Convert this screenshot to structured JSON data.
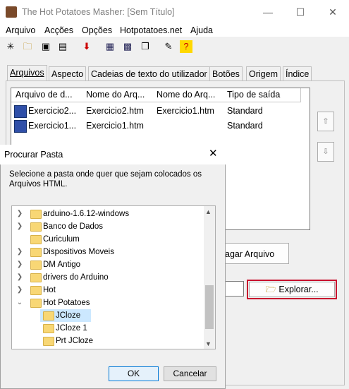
{
  "window": {
    "title": "The Hot Potatoes Masher: [Sem Título]"
  },
  "menu": [
    "Arquivo",
    "Acções",
    "Opções",
    "Hotpotatoes.net",
    "Ajuda"
  ],
  "tabs": [
    "Arquivos",
    "Aspecto",
    "Cadeias de texto do utilizador",
    "Botões",
    "Origem",
    "Índice"
  ],
  "table": {
    "headers": [
      "Arquivo de d...",
      "Nome do Arq...",
      "Nome do Arq...",
      "Tipo de saída"
    ],
    "rows": [
      [
        "Exercicio2...",
        "Exercicio2.htm",
        "Exercicio1.htm",
        "Standard"
      ],
      [
        "Exercicio1...",
        "Exercicio1.htm",
        "",
        "Standard"
      ]
    ]
  },
  "buttons": {
    "delete_file": "agar Arquivo",
    "explore": "Explorar...",
    "field_fragment": "\\"
  },
  "dialog": {
    "title": "Procurar Pasta",
    "description": "Selecione a pasta onde quer que sejam colocados os Arquivos HTML.",
    "ok": "OK",
    "cancel": "Cancelar",
    "tree": [
      "arduino-1.6.12-windows",
      "Banco de  Dados",
      "Curiculum",
      "Dispositivos Moveis",
      "DM Antigo",
      "drivers do Arduino",
      "Hot",
      "Hot Potatoes",
      "JCloze",
      "JCloze 1",
      "Prt JCloze"
    ]
  }
}
